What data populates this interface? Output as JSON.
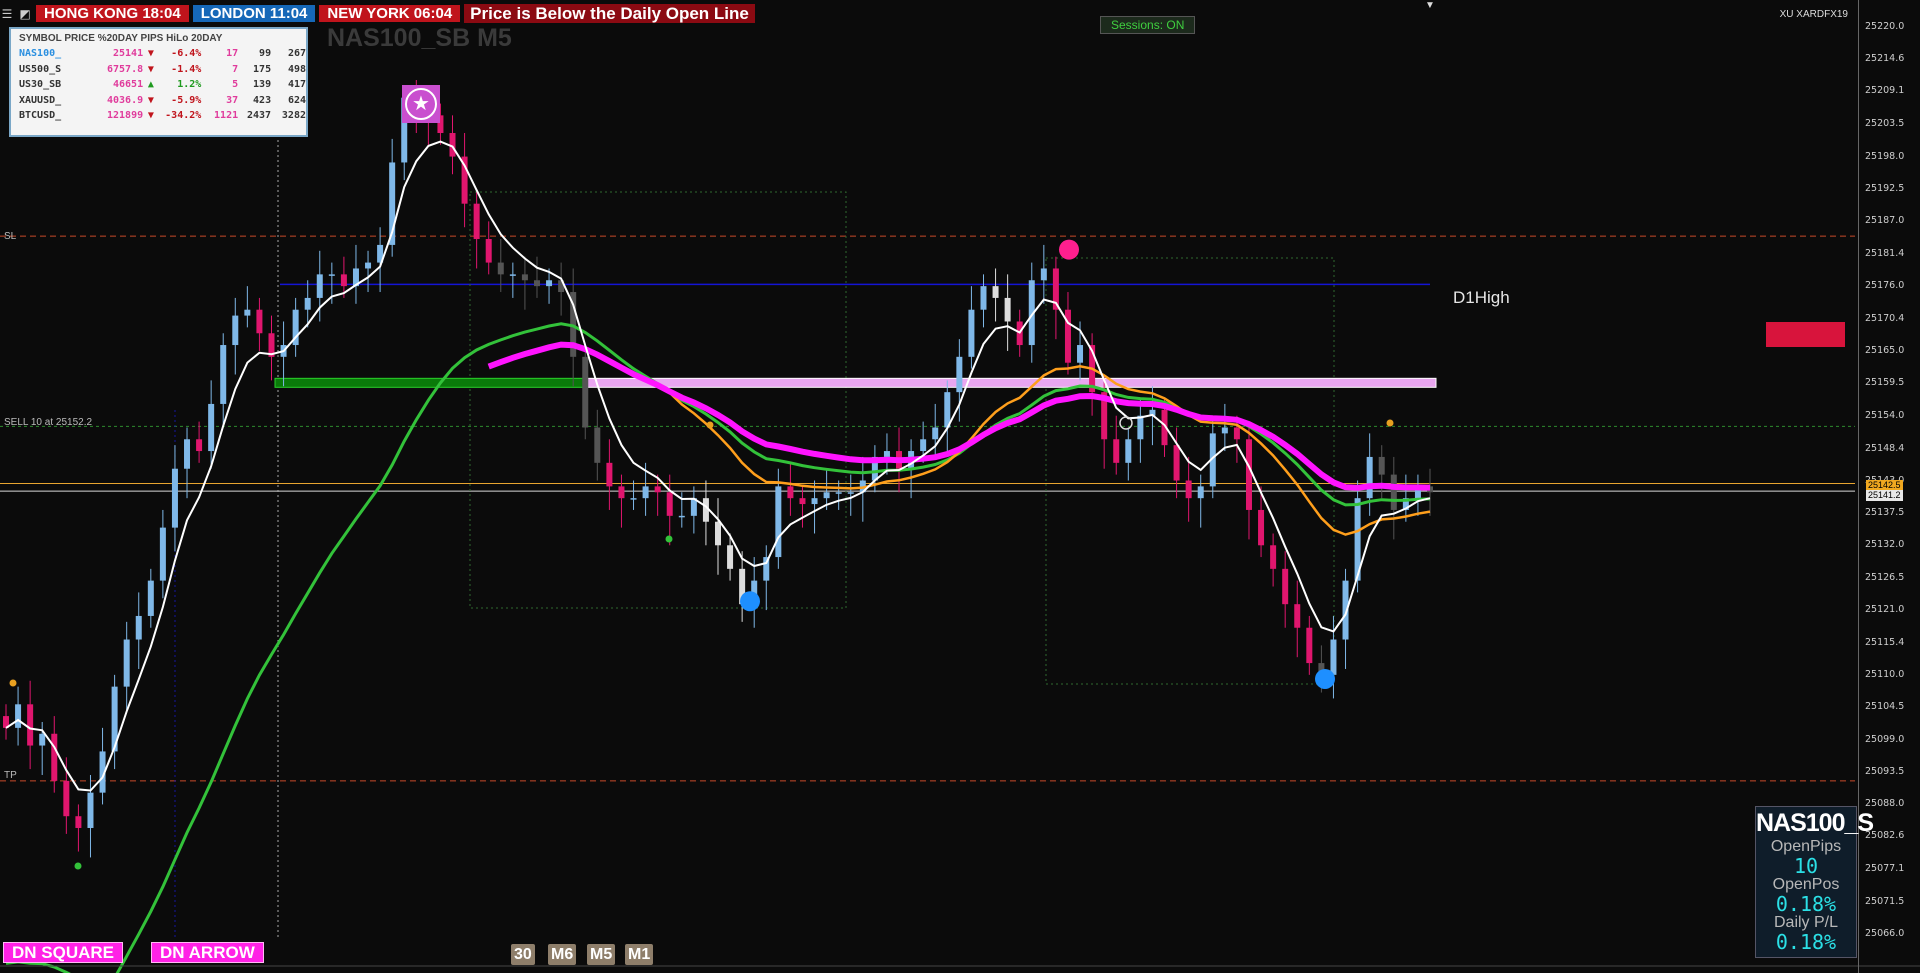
{
  "header": {
    "sessions": [
      {
        "label": "HONG KONG 18:04",
        "color": "#c0141c"
      },
      {
        "label": "LONDON  11:04",
        "color": "#1668b8"
      },
      {
        "label": "NEW YORK  06:04",
        "color": "#c0141c"
      }
    ],
    "message": "Price is Below the Daily Open Line",
    "sessions_toggle": "Sessions: ON",
    "broker": "XU XARDFX19",
    "symbol_title": "NAS100_SB M5"
  },
  "table": {
    "header": "SYMBOL PRICE %20DAY PIPS HiLo 20DAY",
    "rows": [
      {
        "symbol": "NAS100_",
        "price": "25141",
        "arrow": "▼",
        "pct": "-6.4%",
        "pips": "17",
        "hilo": "99",
        "d20": "267",
        "sym_color": "#2a8fe0",
        "pct_color": "#c0141c"
      },
      {
        "symbol": "US500_S",
        "price": "6757.8",
        "arrow": "▼",
        "pct": "-1.4%",
        "pips": "7",
        "hilo": "175",
        "d20": "498",
        "sym_color": "#333333",
        "pct_color": "#c0141c"
      },
      {
        "symbol": "US30_SB",
        "price": "46651",
        "arrow": "▲",
        "pct": "1.2%",
        "pips": "5",
        "hilo": "139",
        "d20": "417",
        "sym_color": "#333333",
        "pct_color": "#1f9a1f"
      },
      {
        "symbol": "XAUUSD_",
        "price": "4036.9",
        "arrow": "▼",
        "pct": "-5.9%",
        "pips": "37",
        "hilo": "423",
        "d20": "624",
        "sym_color": "#333333",
        "pct_color": "#c0141c"
      },
      {
        "symbol": "BTCUSD_",
        "price": "121899",
        "arrow": "▼",
        "pct": "-34.2%",
        "pips": "1121",
        "hilo": "2437",
        "d20": "3282",
        "sym_color": "#333333",
        "pct_color": "#c0141c"
      }
    ]
  },
  "labels": {
    "sl": "SL",
    "sell": "SELL 10 at 25152.2",
    "tp": "TP",
    "d1high": "D1High"
  },
  "buttons": {
    "dn_square": "DN SQUARE",
    "dn_arrow": "DN ARROW",
    "timeframes": [
      "30",
      "M6",
      "M5",
      "M1"
    ]
  },
  "panel": {
    "symbol": "NAS100_S",
    "open_pips_label": "OpenPips",
    "open_pips": "10",
    "open_pos_label": "OpenPos",
    "open_pos": "0.18%",
    "daily_pl_label": "Daily P/L",
    "daily_pl": "0.18%"
  },
  "price_tags": {
    "upper": "25142.5",
    "lower": "25141.2"
  },
  "chart_data": {
    "type": "candlestick",
    "symbol": "NAS100_SB",
    "timeframe": "M5",
    "ylim": [
      25063,
      25223
    ],
    "yticks": [
      "25220.0",
      "25214.6",
      "25209.1",
      "25203.5",
      "25198.0",
      "25192.5",
      "25187.0",
      "25181.4",
      "25176.0",
      "25170.4",
      "25165.0",
      "25159.5",
      "25154.0",
      "25148.4",
      "25143.0",
      "25137.5",
      "25132.0",
      "25126.5",
      "25121.0",
      "25115.4",
      "25110.0",
      "25104.5",
      "25099.0",
      "25093.5",
      "25088.0",
      "25082.6",
      "25077.1",
      "25071.5",
      "25066.0"
    ],
    "levels": {
      "sl": 25184.5,
      "d1high": 25176.3,
      "sell_entry": 25152.2,
      "bid": 25142.5,
      "ask": 25141.2,
      "tp": 25092.0
    },
    "closes": [
      25101,
      25105,
      25098,
      25100,
      25092,
      25086,
      25084,
      25090,
      25097,
      25108,
      25116,
      25120,
      25126,
      25135,
      25145,
      25150,
      25148,
      25156,
      25166,
      25171,
      25172,
      25168,
      25164,
      25166,
      25172,
      25174,
      25178,
      25178,
      25176,
      25179,
      25180,
      25183,
      25197,
      25208,
      25206,
      25205,
      25202,
      25198,
      25190,
      25184,
      25180,
      25178,
      25178,
      25177,
      25176,
      25177,
      25175,
      25164,
      25152,
      25146,
      25142,
      25140,
      25140,
      25142,
      25141,
      25137,
      25137,
      25140,
      25136,
      25132,
      25128,
      25122,
      25126,
      25130,
      25142,
      25140,
      25139,
      25140,
      25141,
      25141,
      25141,
      25143,
      25147,
      25148,
      25145,
      25148,
      25150,
      25152,
      25158,
      25164,
      25172,
      25176,
      25174,
      25170,
      25166,
      25177,
      25179,
      25172,
      25163,
      25166,
      25158,
      25150,
      25146,
      25150,
      25154,
      25155,
      25149,
      25143,
      25140,
      25142,
      25151,
      25152,
      25150,
      25138,
      25132,
      25128,
      25122,
      25118,
      25112,
      25110,
      25116,
      25126,
      25140,
      25147,
      25144,
      25138,
      25140,
      25142,
      25141
    ],
    "series": [
      {
        "name": "fast-ma",
        "color": "#ffffff"
      },
      {
        "name": "ma-orange",
        "color": "#ff9f1c"
      },
      {
        "name": "ma-green",
        "color": "#33c23a"
      },
      {
        "name": "ma-magenta",
        "color": "#ff14ff"
      }
    ],
    "markers": [
      {
        "type": "buy-dot",
        "price": 25122.5,
        "color": "#1e8fff"
      },
      {
        "type": "buy-dot",
        "price": 25109.3,
        "color": "#1e8fff"
      },
      {
        "type": "sell-dot",
        "price": 25182.2,
        "color": "#ff1f8e"
      }
    ],
    "zones": [
      {
        "name": "demand-zone",
        "price": 25159.5,
        "color": "#0a7a0a"
      },
      {
        "name": "supply-zone",
        "price": 25159.5,
        "color": "#e9a6f0"
      }
    ]
  }
}
